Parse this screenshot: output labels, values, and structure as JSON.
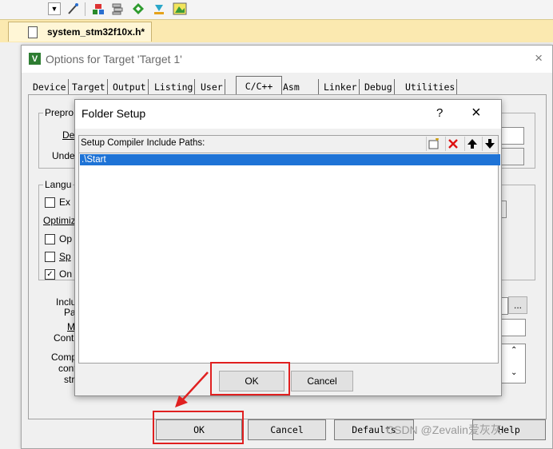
{
  "editor": {
    "file_tab": "system_stm32f10x.h*"
  },
  "toolbar": {
    "icons": [
      "dropdown-icon",
      "wand-icon",
      "target-icon",
      "stack-icon",
      "diamond-icon",
      "download-icon",
      "chip-icon"
    ]
  },
  "options": {
    "title": "Options for Target 'Target 1'",
    "close": "×",
    "tabs": [
      "Device",
      "Target",
      "Output",
      "Listing",
      "User",
      "C/C++",
      "Asm",
      "Linker",
      "Debug",
      "Utilities"
    ],
    "active_tab": "C/C++",
    "left_labels": {
      "prepro": "Prepro",
      "def": "Def",
      "undef": "Undef",
      "langu": "Langu",
      "ex": "Ex",
      "optimiz": "Optimiz",
      "op": "Op",
      "sp": "Sp",
      "on": "On",
      "inclu": "Inclu",
      "pat": "Pat",
      "m": "M",
      "contr": "Contr",
      "comp": "Comp",
      "cont": "cont",
      "stri": "stri"
    },
    "browse_button": "...",
    "buttons": {
      "ok": "OK",
      "cancel": "Cancel",
      "defaults": "Defaults",
      "help": "Help"
    }
  },
  "folder_setup": {
    "title": "Folder Setup",
    "help": "?",
    "close": "×",
    "header_label": "Setup Compiler Include Paths:",
    "paths": [
      ".\\Start"
    ],
    "ok": "OK",
    "cancel": "Cancel"
  },
  "watermark": "CSDN @Zevalin爱灰灰",
  "colors": {
    "highlight": "#1e73d6",
    "annotation": "#e02020",
    "tab_bar": "#fbe9b0"
  }
}
